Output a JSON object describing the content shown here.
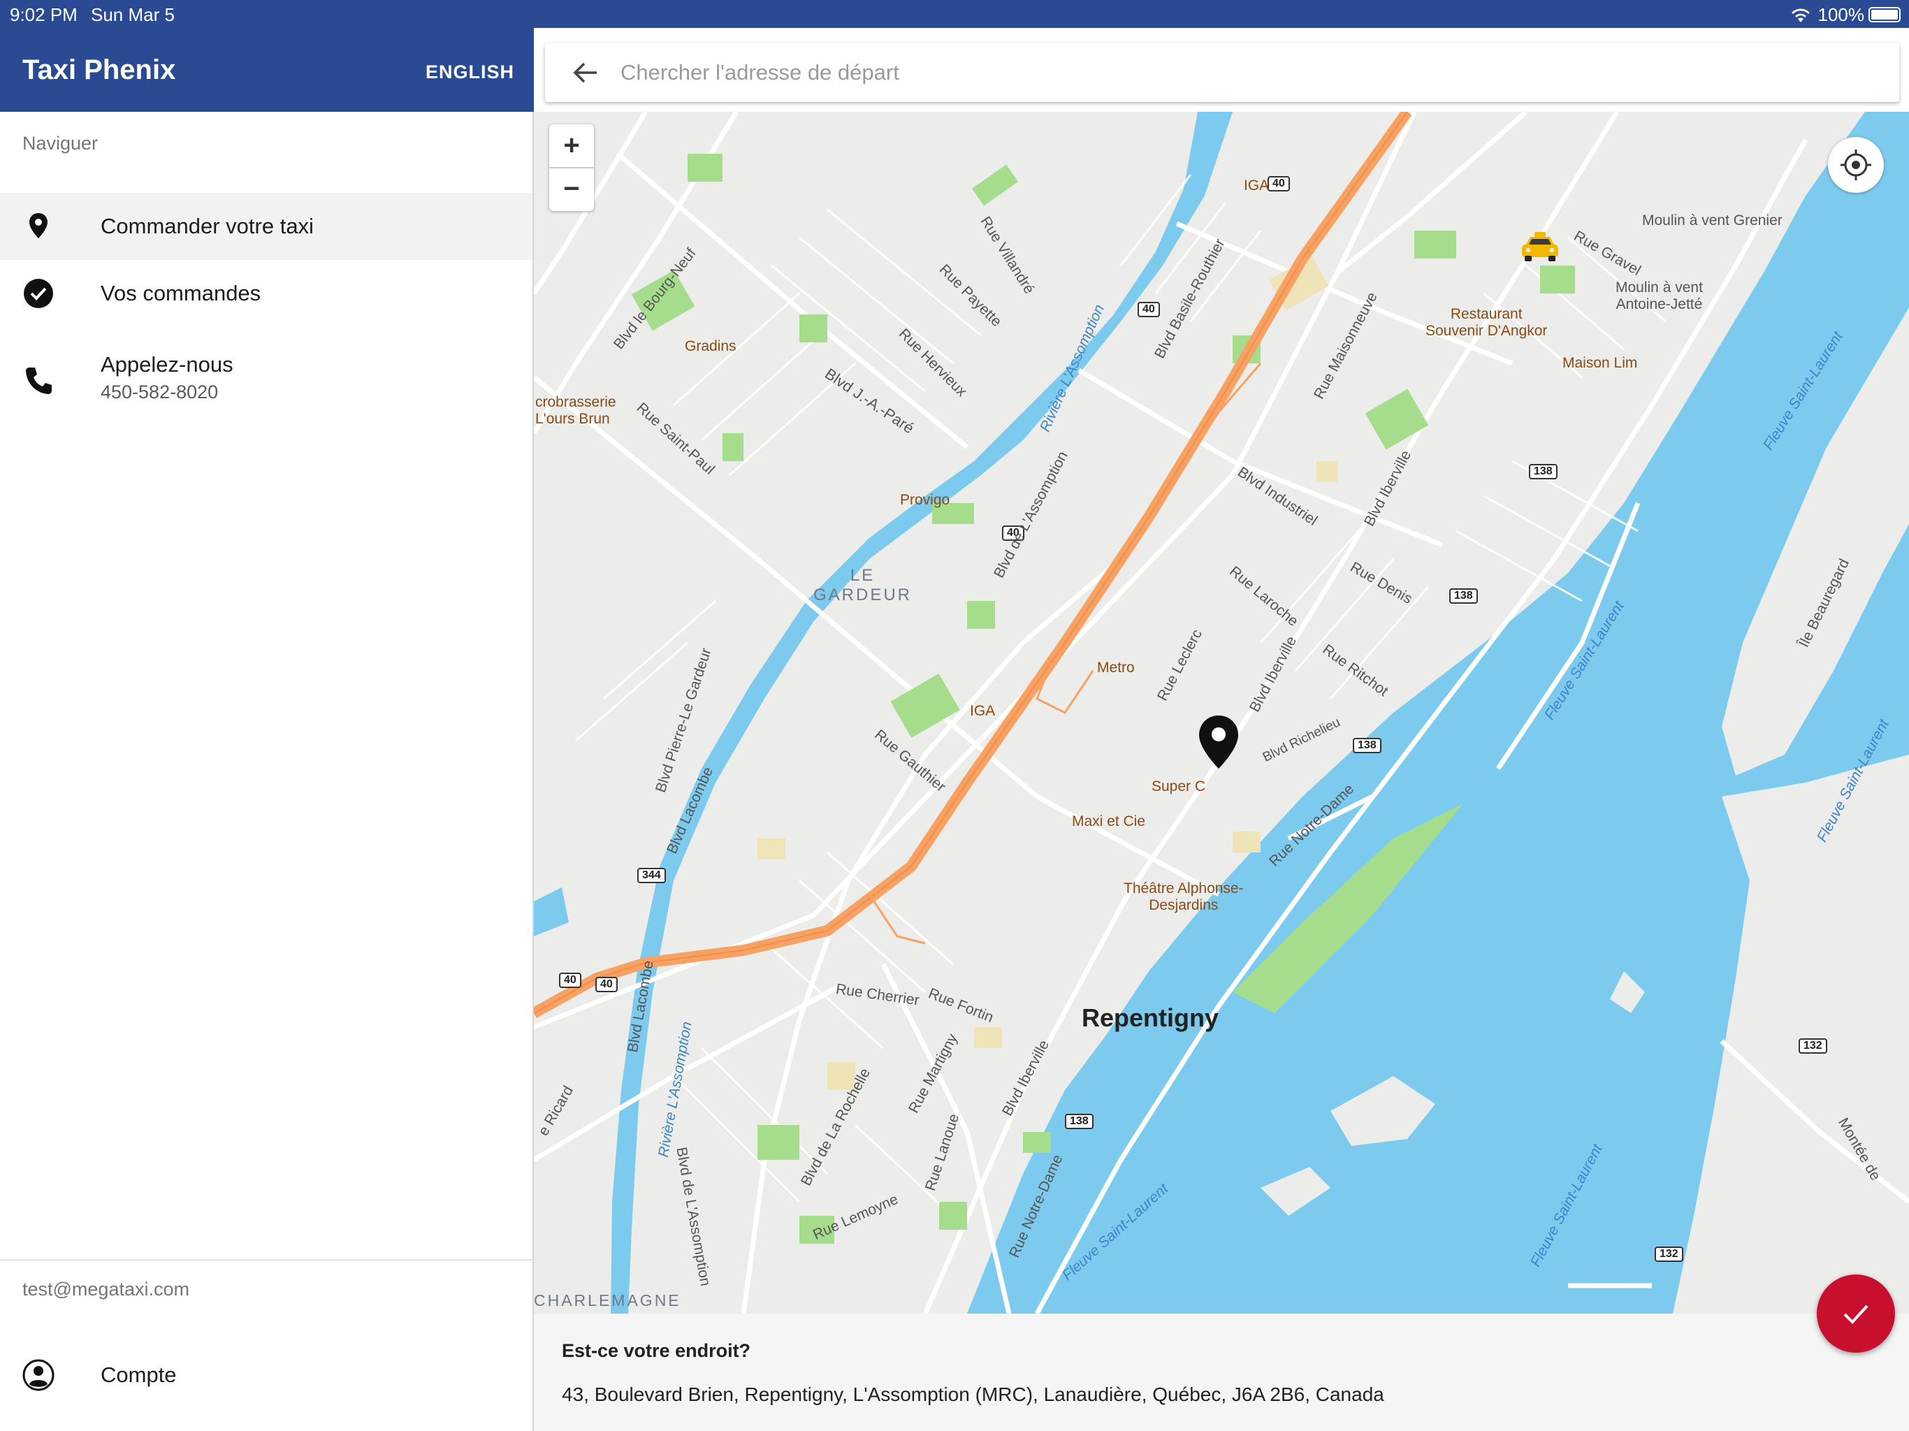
{
  "status_bar": {
    "time": "9:02 PM",
    "date": "Sun Mar 5",
    "battery": "100%"
  },
  "drawer": {
    "title": "Taxi Phenix",
    "language_button": "ENGLISH",
    "section_label": "Naviguer",
    "items": [
      {
        "label": "Commander votre taxi",
        "icon": "location-pin-icon"
      },
      {
        "label": "Vos commandes",
        "icon": "check-circle-icon"
      },
      {
        "label": "Appelez-nous",
        "sub": "450-582-8020",
        "icon": "phone-icon"
      }
    ],
    "user_email": "test@megataxi.com",
    "account_label": "Compte"
  },
  "search": {
    "placeholder": "Chercher l'adresse de départ"
  },
  "map": {
    "zoom_in": "+",
    "zoom_out": "−",
    "labels": {
      "city": "Repentigny",
      "le_gardeur": "LE\nGARDEUR",
      "charlemagne": "CHARLEMAGNE",
      "iga1": "IGA",
      "iga2": "IGA",
      "gradins": "Gradins",
      "provigo": "Provigo",
      "metro": "Metro",
      "super_c": "Super C",
      "maxi": "Maxi et Cie",
      "theatre": "Théâtre Alphonse-\nDesjardins",
      "restaurant": "Restaurant\nSouvenir D'Angkor",
      "maison_lim": "Maison Lim",
      "moulin_grenier": "Moulin à vent Grenier",
      "moulin_jette": "Moulin à vent\nAntoine-Jetté",
      "microbrasserie": "crobrasserie\nL'ours Brun",
      "ile_beauregard": "Île Beauregard",
      "fleuve1": "Fleuve Saint-Laurent",
      "fleuve2": "Fleuve Saint-Laurent",
      "fleuve3": "Fleuve Saint-Laurent",
      "fleuve4": "Fleuve Saint-Laurent",
      "fleuve5": "Fleuve Saint-Laurent",
      "riviere1": "Rivière L'Assomption",
      "riviere2": "Rivière L'Assomption",
      "streets": {
        "bourg_neuf": "Blvd le Bourg-Neuf",
        "villandre": "Rue Villandré",
        "payette": "Rue Payette",
        "hervieux": "Rue Hervieux",
        "jap": "Blvd J.-A.-Paré",
        "saint_paul": "Rue Saint-Paul",
        "basile": "Blvd Basile-Routhier",
        "maisonneuve": "Rue Maisonneuve",
        "industriel": "Blvd Industriel",
        "iberville1": "Blvd Iberville",
        "iberville2": "Blvd Iberville",
        "iberville3": "Blvd Iberville",
        "assomption_blvd": "Blvd de L'Assomption",
        "assomption_blvd2": "Blvd de L'Assomption",
        "laroche": "Rue Laroche",
        "denis": "Rue Denis",
        "leclerc": "Rue Leclerc",
        "ritchot": "Rue Ritchot",
        "richelieu": "Blvd Richelieu",
        "notre_dame1": "Rue Notre-Dame",
        "notre_dame2": "Rue Notre-Dame",
        "gravel": "Rue Gravel",
        "pierre_le_gardeur": "Blvd Pierre-Le Gardeur",
        "lacombe1": "Blvd Lacombe",
        "lacombe2": "Blvd Lacombe",
        "gauthier": "Rue Gauthier",
        "cherrier": "Rue Cherrier",
        "fortin": "Rue Fortin",
        "martigny": "Rue Martigny",
        "rochelle": "Blvd de La Rochelle",
        "lanoue": "Rue Lanoue",
        "lemoyne": "Rue Lemoyne",
        "ricard": "e Ricard",
        "montee": "Montée de"
      },
      "highways": [
        "40",
        "40",
        "40",
        "40",
        "40",
        "138",
        "138",
        "138",
        "138",
        "344",
        "132",
        "132"
      ]
    }
  },
  "confirm": {
    "question": "Est-ce votre endroit?",
    "address": "43, Boulevard Brien, Repentigny, L'Assomption (MRC), Lanaudière, Québec, J6A 2B6, Canada"
  },
  "colors": {
    "primary": "#2a4a94",
    "accent": "#c8102e",
    "water": "#7ccbef",
    "park": "#a6dd8d",
    "highway": "#f7a163"
  }
}
